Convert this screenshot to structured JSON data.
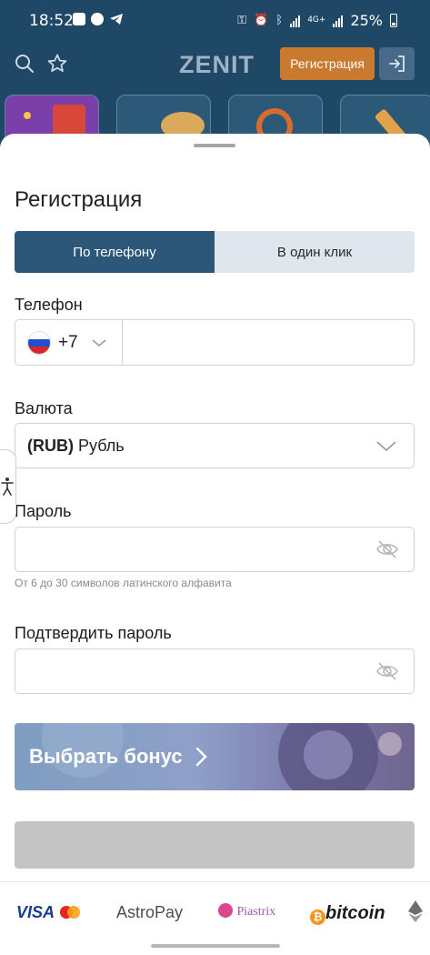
{
  "status_bar": {
    "time": "18:52",
    "battery": "25%",
    "network": "4G+"
  },
  "header": {
    "logo": "ZENIT",
    "register_button": "Регистрация",
    "icons": [
      "search-icon",
      "star-icon",
      "login-icon"
    ]
  },
  "sheet": {
    "title": "Регистрация",
    "tabs": [
      {
        "label": "По телефону",
        "active": true
      },
      {
        "label": "В один клик",
        "active": false
      }
    ],
    "phone": {
      "label": "Телефон",
      "country_code": "+7",
      "value": ""
    },
    "currency": {
      "label": "Валюта",
      "code": "(RUB)",
      "name": "Рубль"
    },
    "password": {
      "label": "Пароль",
      "value": "",
      "hint": "От 6 до 30 символов латинского алфавита"
    },
    "confirm_password": {
      "label": "Подтвердить пароль",
      "value": ""
    },
    "bonus_button": "Выбрать бонус",
    "submit_button": ""
  },
  "payments": {
    "visa": "VISA",
    "astropay": "AstroPay",
    "piastrix": "Piastrix",
    "bitcoin": "bitcoin"
  },
  "colors": {
    "header_bg": "#1f4766",
    "accent_orange": "#c97a2f",
    "tab_active": "#2c5778",
    "tab_inactive": "#dfe6ed",
    "submit_disabled": "#c4c4c4"
  }
}
